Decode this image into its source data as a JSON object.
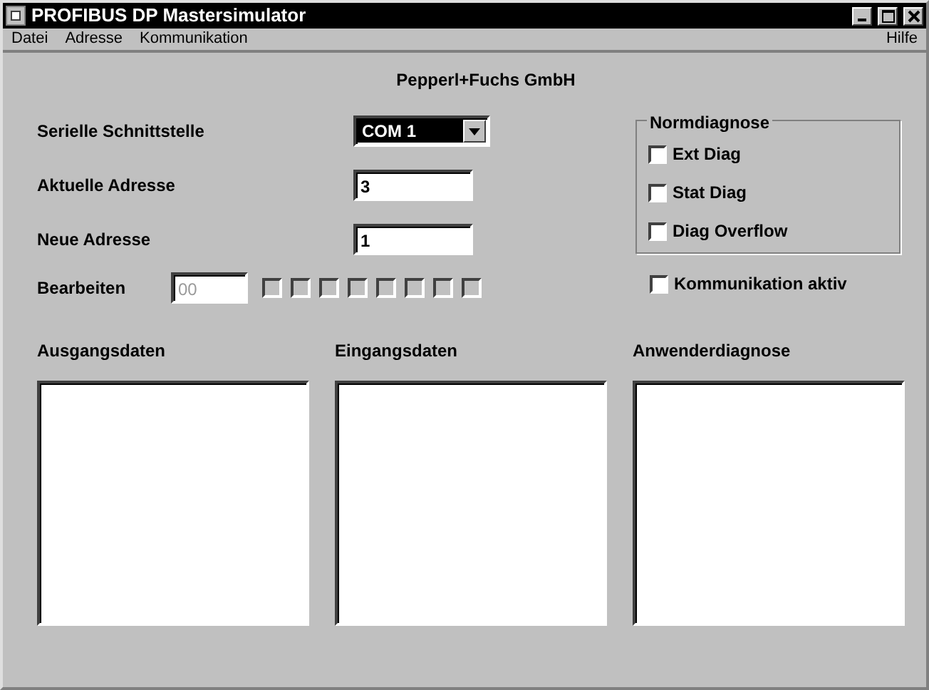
{
  "window": {
    "title": "PROFIBUS DP Mastersimulator"
  },
  "menu": {
    "left": [
      "Datei",
      "Adresse",
      "Kommunikation"
    ],
    "right": "Hilfe"
  },
  "company": "Pepperl+Fuchs GmbH",
  "fields": [
    {
      "kind": "combo",
      "label": "Serielle Schnittstelle",
      "value": "COM 1"
    },
    {
      "kind": "text",
      "label": "Aktuelle Adresse",
      "value": "3"
    },
    {
      "kind": "text",
      "label": "Neue Adresse",
      "value": "1"
    }
  ],
  "edit": {
    "label": "Bearbeiten",
    "value": "00",
    "disabled": true,
    "bits": [
      {
        "checked": false
      },
      {
        "checked": false
      },
      {
        "checked": false
      },
      {
        "checked": false
      },
      {
        "checked": false
      },
      {
        "checked": false
      },
      {
        "checked": false
      },
      {
        "checked": false
      }
    ]
  },
  "normdiagnose": {
    "title": "Normdiagnose",
    "options": [
      {
        "label": "Ext Diag",
        "checked": false
      },
      {
        "label": "Stat Diag",
        "checked": false
      },
      {
        "label": "Diag Overflow",
        "checked": false
      }
    ]
  },
  "kommunikation": {
    "label": "Kommunikation aktiv",
    "checked": false
  },
  "lists": [
    {
      "title": "Ausgangsdaten"
    },
    {
      "title": "Eingangsdaten"
    },
    {
      "title": "Anwenderdiagnose"
    }
  ]
}
